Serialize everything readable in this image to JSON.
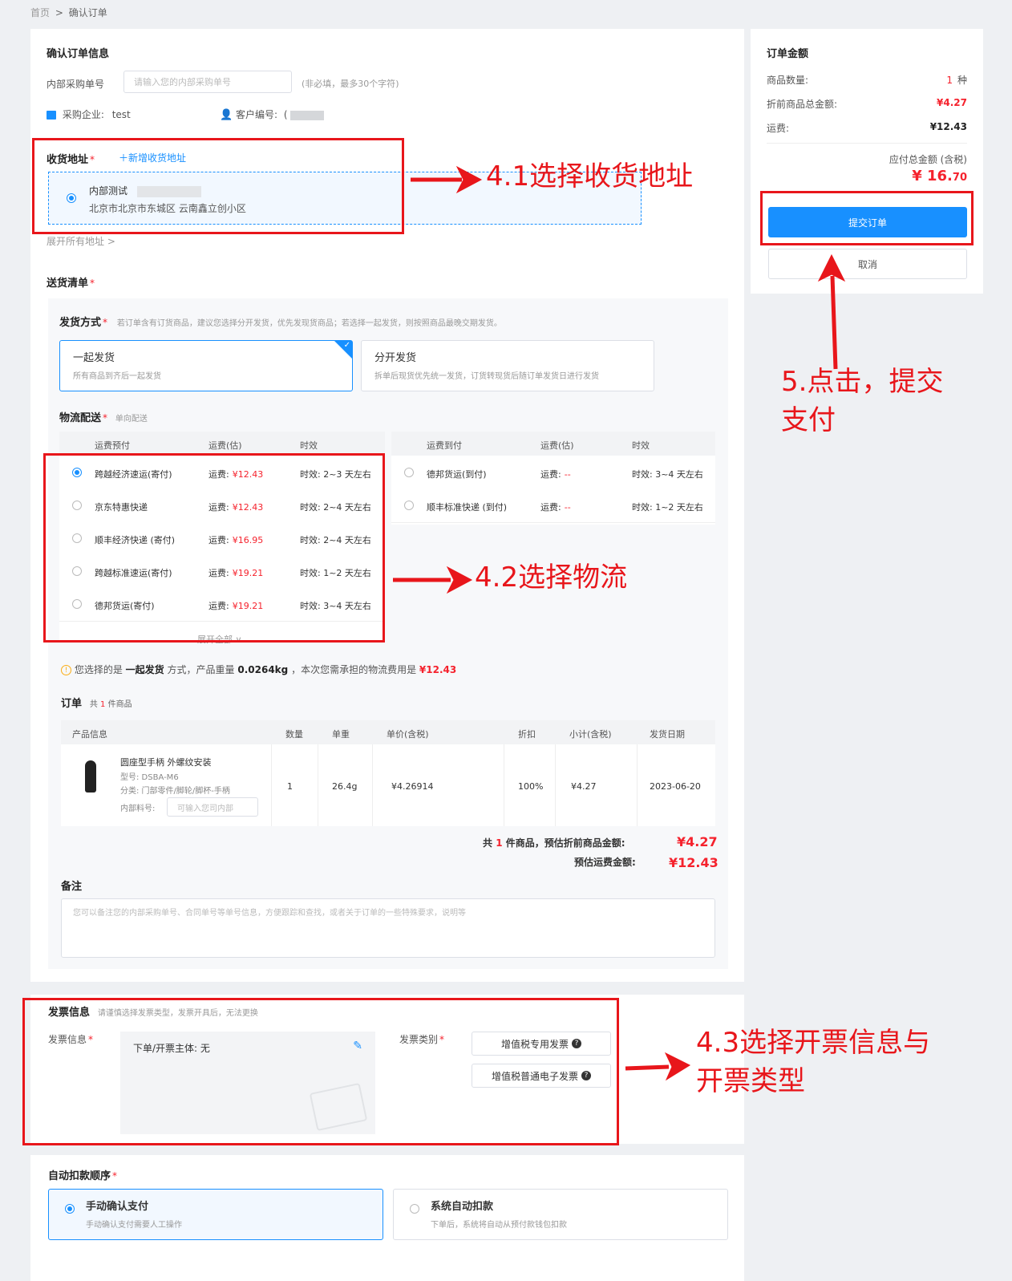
{
  "breadcrumb": {
    "home": "首页",
    "sep": ">",
    "current": "确认订单"
  },
  "order_info": {
    "title": "确认订单信息",
    "po_label": "内部采购单号",
    "po_placeholder": "请输入您的内部采购单号",
    "po_hint": "(非必填，最多30个字符)",
    "company_label": "采购企业:",
    "company_value": "test",
    "customer_label": "客户编号:",
    "customer_value": "("
  },
  "address": {
    "label": "收货地址",
    "req": "*",
    "add_link": "＋新增收货地址",
    "name": "内部测试",
    "detail": "北京市北京市东城区 云南鑫立创小区",
    "expand": "展开所有地址 >"
  },
  "delivery": {
    "title": "送货清单",
    "req": "*",
    "ship_label": "发货方式",
    "ship_req": "*",
    "ship_hint": "若订单含有订货商品，建议您选择分开发货，优先发现货商品；若选择一起发货，则按照商品最晚交期发货。",
    "options": [
      {
        "title": "一起发货",
        "desc": "所有商品到齐后一起发货"
      },
      {
        "title": "分开发货",
        "desc": "拆单后现货优先统一发货，订货转现货后随订单发货日进行发货"
      }
    ],
    "logistics_label": "物流配送",
    "logistics_req": "*",
    "logistics_hint": "单向配送",
    "left_headers": [
      "运费预付",
      "运费(估)",
      "时效"
    ],
    "right_headers": [
      "运费到付",
      "运费(估)",
      "时效"
    ],
    "left_rows": [
      {
        "name": "跨越经济速运(寄付)",
        "fee_label": "运费:",
        "fee": "¥12.43",
        "time": "时效: 2~3 天左右",
        "selected": true
      },
      {
        "name": "京东特惠快递",
        "fee_label": "运费:",
        "fee": "¥12.43",
        "time": "时效: 2~4 天左右",
        "selected": false
      },
      {
        "name": "顺丰经济快递 (寄付)",
        "fee_label": "运费:",
        "fee": "¥16.95",
        "time": "时效: 2~4 天左右",
        "selected": false
      },
      {
        "name": "跨越标准速运(寄付)",
        "fee_label": "运费:",
        "fee": "¥19.21",
        "time": "时效: 1~2 天左右",
        "selected": false
      },
      {
        "name": "德邦货运(寄付)",
        "fee_label": "运费:",
        "fee": "¥19.21",
        "time": "时效: 3~4 天左右",
        "selected": false
      }
    ],
    "right_rows": [
      {
        "name": "德邦货运(到付)",
        "fee_label": "运费:",
        "fee": "--",
        "time": "时效: 3~4 天左右"
      },
      {
        "name": "顺丰标准快递 (到付)",
        "fee_label": "运费:",
        "fee": "--",
        "time": "时效: 1~2 天左右"
      }
    ],
    "expand_all": "展开全部 ∨",
    "summary": {
      "p1": "您选择的是",
      "mode": "一起发货",
      "p2": "方式，产品重量",
      "weight": "0.0264kg",
      "p3": "，本次您需承担的物流费用是",
      "fee": "¥12.43"
    }
  },
  "order": {
    "title": "订单",
    "count_text_1": "共",
    "count": "1",
    "count_text_2": "件商品",
    "headers": [
      "产品信息",
      "数量",
      "单重",
      "单价(含税)",
      "折扣",
      "小计(含税)",
      "发货日期"
    ],
    "item": {
      "name": "圆座型手柄 外螺纹安装",
      "model": "型号: DSBA-M6",
      "category": "分类: 门部零件/脚轮/脚杯-手柄",
      "code_label": "内部料号:",
      "code_placeholder": "可输入您司内部",
      "qty": "1",
      "weight": "26.4g",
      "price": "¥4.26914",
      "discount": "100%",
      "subtotal": "¥4.27",
      "date": "2023-06-20"
    },
    "total_text_1": "共",
    "total_count": "1",
    "total_text_2": "件商品，预估折前商品金额:",
    "total_amount": "¥4.27",
    "freight_label": "预估运费金额:",
    "freight_amount": "¥12.43"
  },
  "remark": {
    "title": "备注",
    "placeholder": "您可以备注您的内部采购单号、合同单号等单号信息，方便跟踪和查找，或者关于订单的一些特殊要求，说明等"
  },
  "invoice": {
    "title": "发票信息",
    "hint": "请谨慎选择发票类型，发票开具后，无法更换",
    "info_label": "发票信息",
    "info_req": "*",
    "subject": "下单/开票主体: 无",
    "type_label": "发票类别",
    "type_req": "*",
    "types": [
      "增值税专用发票",
      "增值税普通电子发票"
    ]
  },
  "payment": {
    "title": "自动扣款顺序",
    "req": "*",
    "options": [
      {
        "title": "手动确认支付",
        "desc": "手动确认支付需要人工操作"
      },
      {
        "title": "系统自动扣款",
        "desc": "下单后，系统将自动从预付款钱包扣款"
      }
    ]
  },
  "summary_panel": {
    "title": "订单金额",
    "qty_label": "商品数量:",
    "qty_value": "1",
    "qty_unit": "种",
    "discount_label": "折前商品总金额:",
    "discount_value": "¥4.27",
    "freight_label": "运费:",
    "freight_value": "¥12.43",
    "total_label": "应付总金额 (含税)",
    "total_main": "¥ 16.",
    "total_cents": "70",
    "submit": "提交订单",
    "cancel": "取消"
  },
  "annotations": {
    "a41": "4.1选择收货地址",
    "a42": "4.2选择物流",
    "a43_1": "4.3选择开票信息与",
    "a43_2": "开票类型",
    "a5_1": "5.点击，提交",
    "a5_2": "支付"
  },
  "colors": {
    "accent": "#1890ff",
    "price": "#f5222d",
    "annotation": "#e8161b"
  }
}
